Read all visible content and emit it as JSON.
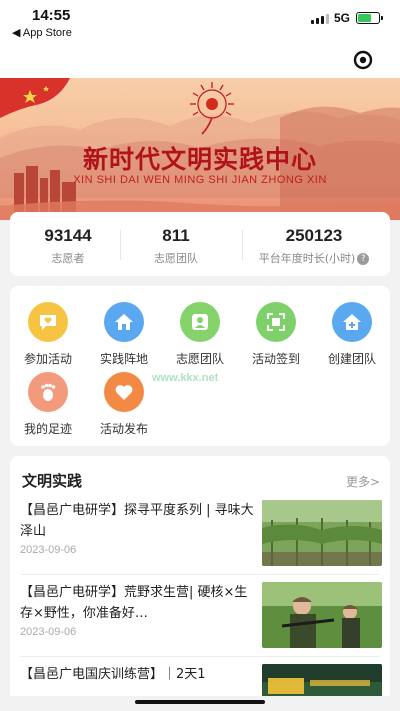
{
  "status_bar": {
    "time": "14:55",
    "back_app": "◀ App Store",
    "network": "5G"
  },
  "nav": {
    "eye_icon": "eye-icon"
  },
  "banner": {
    "title": "新时代文明实践中心",
    "subtitle": "XIN SHI DAI WEN MING SHI JIAN ZHONG XIN"
  },
  "stats": [
    {
      "value": "93144",
      "label": "志愿者"
    },
    {
      "value": "811",
      "label": "志愿团队"
    },
    {
      "value": "250123",
      "label": "平台年度时长(小时)"
    }
  ],
  "features": [
    {
      "label": "参加活动",
      "icon": "chat-heart-icon",
      "color": "#f6c343"
    },
    {
      "label": "实践阵地",
      "icon": "home-icon",
      "color": "#5aa8f0"
    },
    {
      "label": "志愿团队",
      "icon": "team-icon",
      "color": "#86d26a"
    },
    {
      "label": "活动签到",
      "icon": "scan-icon",
      "color": "#7dd06a"
    },
    {
      "label": "创建团队",
      "icon": "add-home-icon",
      "color": "#5aa8f0"
    },
    {
      "label": "我的足迹",
      "icon": "footprint-icon",
      "color": "#f39a7d"
    },
    {
      "label": "活动发布",
      "icon": "heart-icon",
      "color": "#f28a45"
    }
  ],
  "watermark": "www.kkx.net",
  "news": {
    "section_title": "文明实践",
    "more_label": "更多>",
    "items": [
      {
        "title": "【昌邑广电研学】探寻平度系列 | 寻味大泽山",
        "date": "2023-09-06"
      },
      {
        "title": "【昌邑广电研学】荒野求生营| 硬核×生存×野性，你准备好…",
        "date": "2023-09-06"
      },
      {
        "title": "【昌邑广电国庆训练营】｜2天1",
        "date": ""
      }
    ]
  },
  "colors": {
    "banner_title": "#b0131a",
    "accent_green": "#34c759"
  }
}
